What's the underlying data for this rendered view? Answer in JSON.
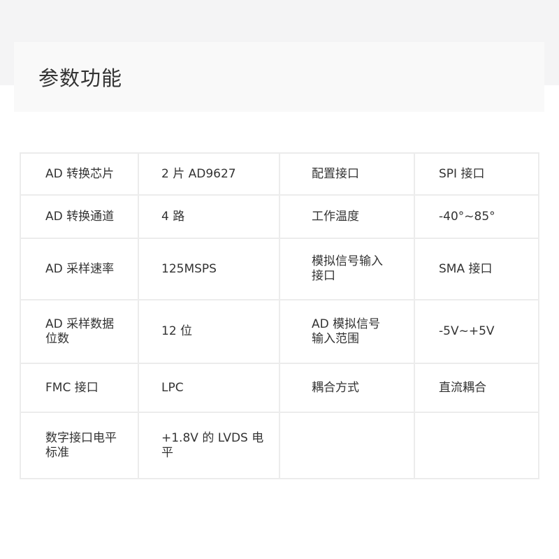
{
  "header": {
    "title": "参数功能"
  },
  "table": {
    "rows": [
      [
        "AD 转换芯片",
        "2 片 AD9627",
        "配置接口",
        "SPI 接口"
      ],
      [
        "AD 转换通道",
        "4 路",
        "工作温度",
        "-40°~85°"
      ],
      [
        "AD 采样速率",
        "125MSPS",
        "模拟信号输入\n接口",
        "SMA 接口"
      ],
      [
        "AD 采样数据\n位数",
        "12 位",
        "AD 模拟信号\n输入范围",
        "-5V~+5V"
      ],
      [
        "FMC 接口",
        "LPC",
        "耦合方式",
        "直流耦合"
      ],
      [
        "数字接口电平\n标准",
        "+1.8V 的 LVDS 电平",
        "",
        ""
      ]
    ]
  }
}
